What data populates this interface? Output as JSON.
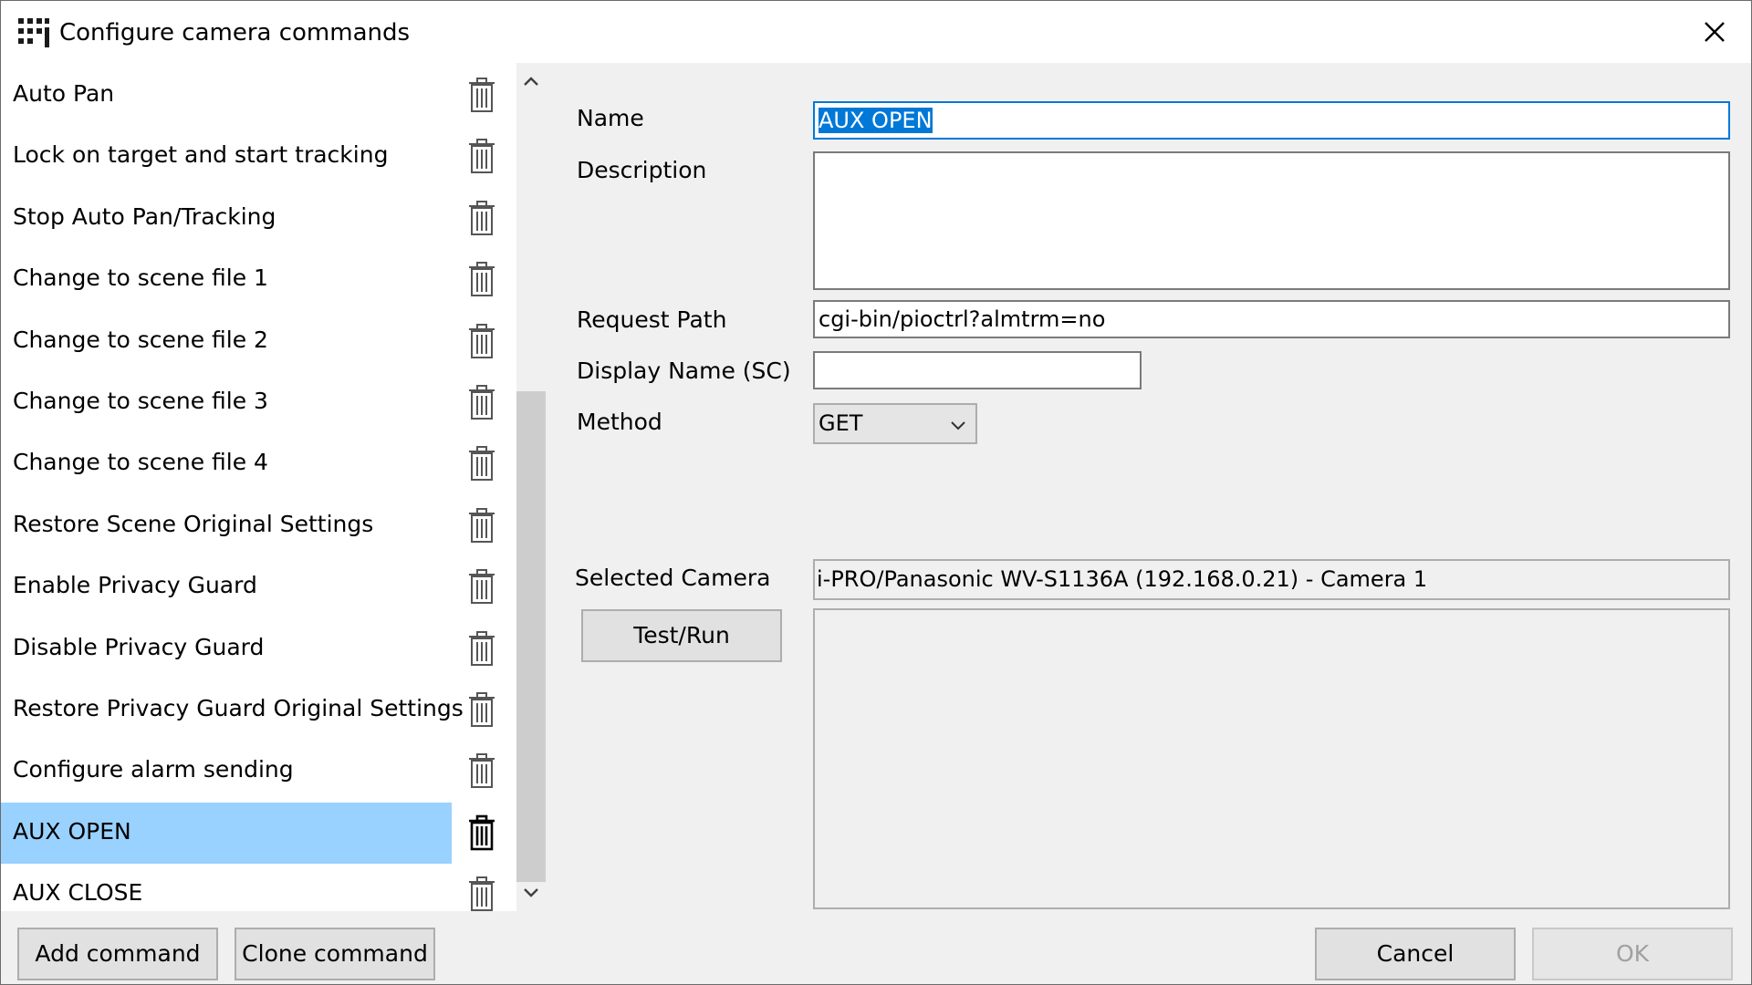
{
  "window": {
    "title": "Configure camera commands"
  },
  "commands": [
    "Auto Pan",
    "Lock on target and start tracking",
    "Stop Auto Pan/Tracking",
    "Change to scene file 1",
    "Change to scene file 2",
    "Change to scene file 3",
    "Change to scene file 4",
    "Restore Scene Original Settings",
    "Enable Privacy Guard",
    "Disable Privacy Guard",
    "Restore Privacy Guard Original Settings",
    "Configure alarm sending",
    "AUX OPEN",
    "AUX CLOSE"
  ],
  "selected_command": "AUX OPEN",
  "form": {
    "name_label": "Name",
    "name_value": "AUX OPEN",
    "description_label": "Description",
    "description_value": "",
    "request_path_label": "Request Path",
    "request_path_value": "cgi-bin/pioctrl?almtrm=no",
    "display_name_label": "Display Name (SC)",
    "display_name_value": "",
    "method_label": "Method",
    "method_value": "GET",
    "selected_camera_label": "Selected Camera",
    "selected_camera_value": "i-PRO/Panasonic WV-S1136A (192.168.0.21) - Camera 1",
    "test_run_label": "Test/Run",
    "output_value": ""
  },
  "buttons": {
    "add_command": "Add command",
    "clone_command": "Clone command",
    "cancel": "Cancel",
    "ok": "OK"
  },
  "colors": {
    "selection": "#99d1ff",
    "focus_border": "#0078d7",
    "text_highlight": "#0078d7"
  }
}
